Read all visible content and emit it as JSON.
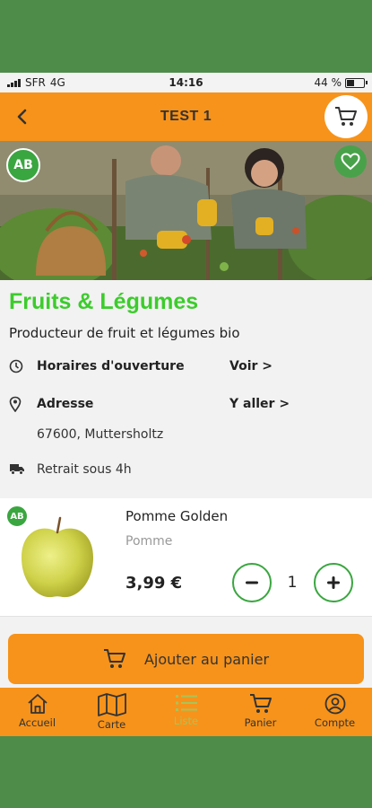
{
  "status_bar": {
    "carrier": "SFR",
    "network": "4G",
    "time": "14:16",
    "battery": "44 %",
    "battery_level": 0.44
  },
  "header": {
    "title": "TEST 1",
    "back_icon": "chevron-left-icon",
    "cart_icon": "cart-icon"
  },
  "hero": {
    "bio_badge": "AB",
    "favorite_icon": "heart-icon"
  },
  "shop": {
    "name": "Fruits & Légumes",
    "description": "Producteur de fruit et légumes bio",
    "hours_label": "Horaires d'ouverture",
    "hours_action": "Voir >",
    "address_label": "Adresse",
    "address_action": "Y aller >",
    "address_value": "67600, Muttersholtz",
    "pickup": "Retrait sous 4h"
  },
  "product": {
    "badge": "AB",
    "name": "Pomme Golden",
    "category": "Pomme",
    "price": "3,99 €",
    "quantity": "1"
  },
  "add_to_cart_label": "Ajouter au panier",
  "tabs": [
    {
      "label": "Accueil",
      "icon": "home-icon"
    },
    {
      "label": "Carte",
      "icon": "map-icon"
    },
    {
      "label": "Liste",
      "icon": "list-icon"
    },
    {
      "label": "Panier",
      "icon": "cart-icon"
    },
    {
      "label": "Compte",
      "icon": "account-icon"
    }
  ],
  "colors": {
    "accent": "#f7931a",
    "green": "#3aa640",
    "title_green": "#3ccc2c",
    "background": "#4e8c4a"
  }
}
